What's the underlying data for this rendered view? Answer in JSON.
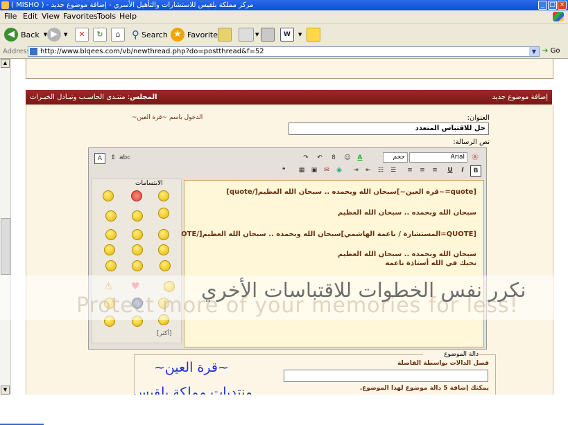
{
  "window": {
    "title": "( MISHO ) - مركز مملكة بلقيس للاستشارات والتأهيل الأسري - إضافة موضوع جديد",
    "minimize": "_",
    "maximize": "□",
    "close": "×"
  },
  "menu": [
    "File",
    "Edit",
    "View",
    "Favorites",
    "Tools",
    "Help"
  ],
  "toolbar": {
    "back": "Back",
    "search": "Search",
    "favorites": "Favorites"
  },
  "address": {
    "label": "Address",
    "url": "http://www.blqees.com/vb/newthread.php?do=postthread&f=52",
    "go": "Go"
  },
  "forum": {
    "header_right": "إضافة موضوع جديد",
    "header_left_bold": "المجلس",
    "header_left": ": منتـدى الحاسـب وتبـادل الخبـرات",
    "title_label": "العنوان:",
    "logged_in": "الدخول باسم ~قرة العين~",
    "title_value": "حل للاقتباس المتعدد",
    "message_label": "نص الرسالة:",
    "font_select": "Arial",
    "size_select": "حجم",
    "bold": "B",
    "italic": "I",
    "underline": "U",
    "smilies_title": "الابتسامات",
    "more_smilies": "[أكثر]",
    "message_lines": [
      "[quote=~قرة العين~]سبحان الله وبحمده .. سبحان الله العظيم[/quote]",
      "سبحان الله وبحمده .. سبحان الله العظيم",
      "[QUOTE=المستشارة / ناعمة الهاشمي]سبحان الله وبحمده .. سبحان الله العظيم[/QUOTE]",
      "سبحان الله وبحمده .. سبحان الله العظيم",
      "نحبك في الله أستاذة ناعمة"
    ],
    "overlay_text": "نكرر نفس الخطوات للاقتباسات الأخري",
    "watermark": "Protect more of your memories for less!",
    "tags_legend": "دالة الموضوع",
    "tags_help": "فصل الدالات بواسطة الفاصلة",
    "tags_limit": "يمكنك إضافة 5 دالة موضوع لهذا الموضوع.",
    "signature_line1": "~قرة العين~",
    "signature_line2": "منتديات مملكة بلقيس"
  },
  "icons": {
    "back": "back-arrow-icon",
    "forward": "forward-arrow-icon",
    "stop": "stop-icon",
    "refresh": "refresh-icon",
    "home": "home-icon",
    "search": "search-icon",
    "favorites": "favorites-star-icon",
    "history": "history-icon",
    "mail": "mail-icon",
    "print": "print-icon",
    "word": "word-icon",
    "messenger": "messenger-icon"
  },
  "colors": {
    "header_bg": "#8a1e1b",
    "panel_bg": "#fdf5e4",
    "message_text": "#6b2f12",
    "signature": "#1a32d6"
  }
}
